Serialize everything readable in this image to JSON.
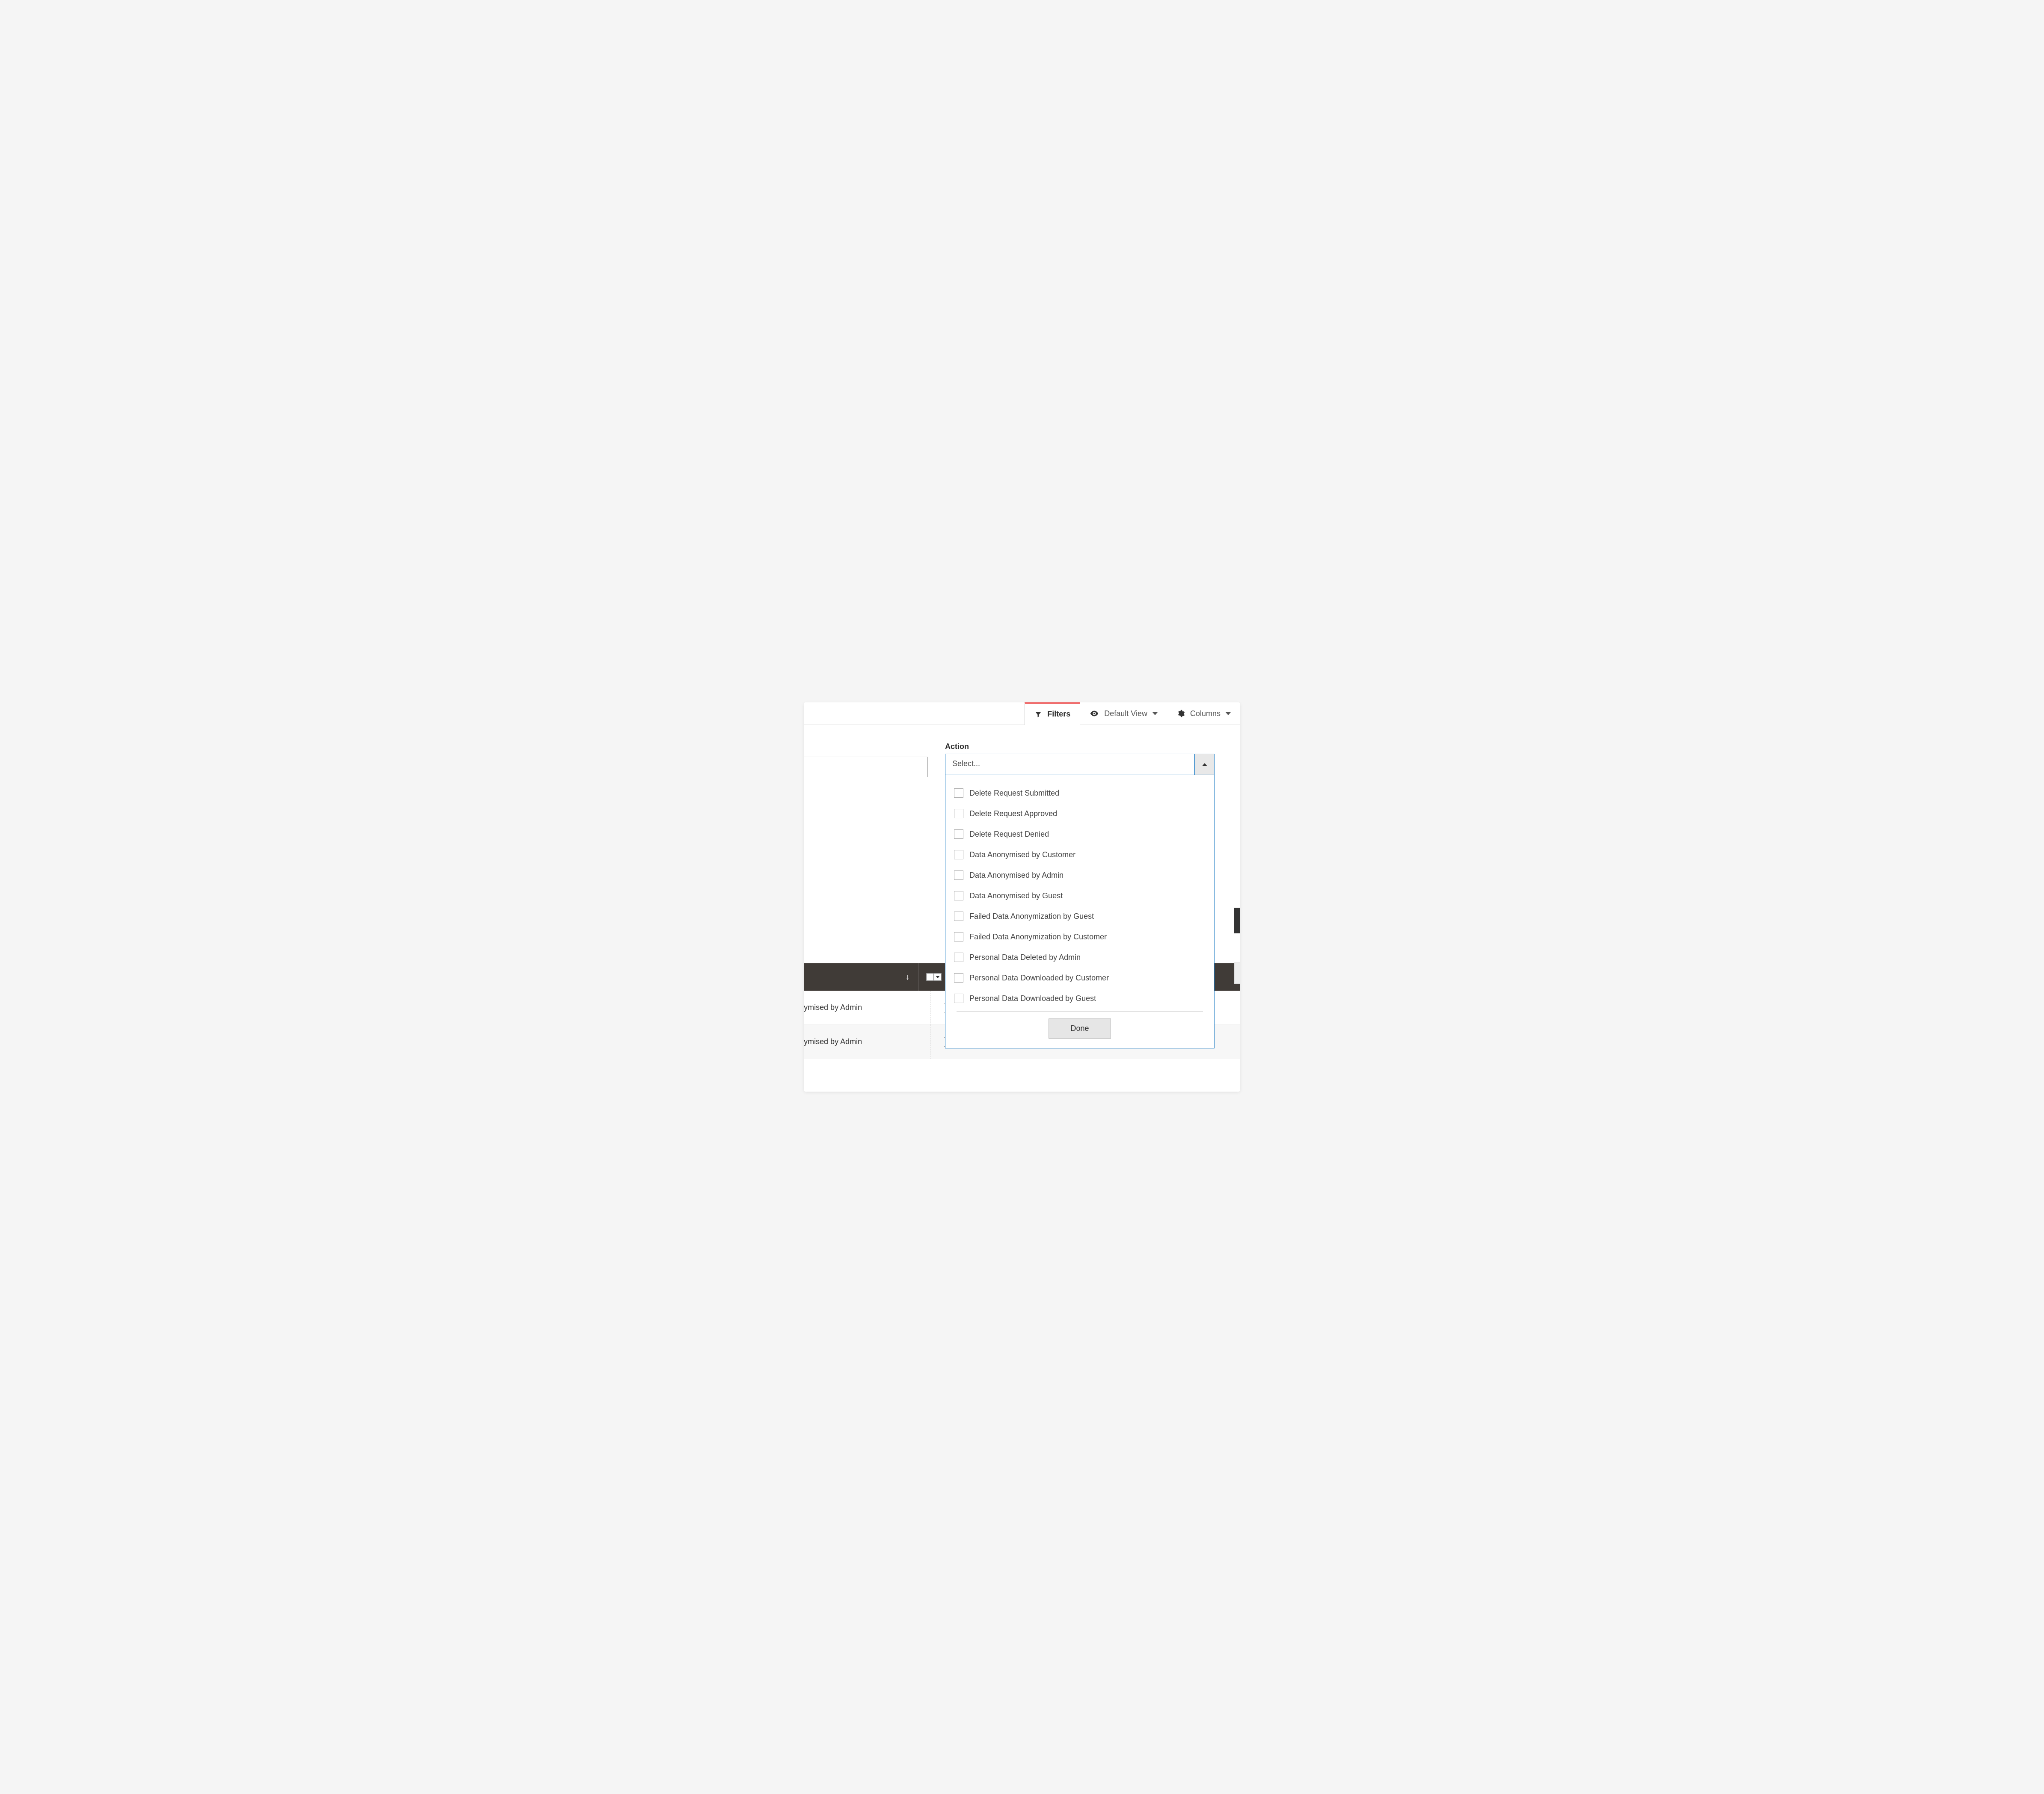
{
  "toolbar": {
    "filters": "Filters",
    "default_view": "Default View",
    "columns": "Columns"
  },
  "filter": {
    "action_label": "Action",
    "select_placeholder": "Select...",
    "done": "Done",
    "options": [
      "Delete Request Submitted",
      "Delete Request Approved",
      "Delete Request Denied",
      "Data Anonymised by Customer",
      "Data Anonymised by Admin",
      "Data Anonymised by Guest",
      "Failed Data Anonymization by Guest",
      "Failed Data Anonymization by Customer",
      "Personal Data Deleted by Admin",
      "Personal Data Downloaded by Customer",
      "Personal Data Downloaded by Guest"
    ]
  },
  "grid": {
    "sort_indicator": "↓",
    "rows": [
      "ymised by Admin",
      "ymised by Admin"
    ]
  }
}
